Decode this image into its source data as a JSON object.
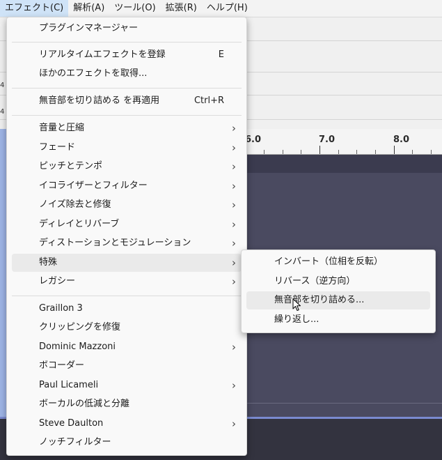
{
  "menubar": {
    "items": [
      "エフェクト(C)",
      "解析(A)",
      "ツール(O)",
      "拡張(R)",
      "ヘルプ(H)"
    ]
  },
  "ruler": {
    "ticks": [
      "6.0",
      "7.0",
      "8.0"
    ]
  },
  "side_digits": [
    "4",
    "4"
  ],
  "effect_menu": {
    "plugin_manager": "プラグインマネージャー",
    "register_realtime": "リアルタイムエフェクトを登録",
    "register_realtime_shortcut": "E",
    "get_more": "ほかのエフェクトを取得...",
    "reapply": "無音部を切り詰める を再適用",
    "reapply_shortcut": "Ctrl+R",
    "categories": [
      "音量と圧縮",
      "フェード",
      "ピッチとテンポ",
      "イコライザーとフィルター",
      "ノイズ除去と修復",
      "ディレイとリバーブ",
      "ディストーションとモジュレーション",
      "特殊",
      "レガシー"
    ],
    "plugins": [
      "Graillon 3",
      "クリッピングを修復",
      "Dominic Mazzoni",
      "ボコーダー",
      "Paul Licameli",
      "ボーカルの低減と分離",
      "Steve Daulton",
      "ノッチフィルター"
    ]
  },
  "special_submenu": {
    "items": [
      "インバート（位相を反転）",
      "リバース（逆方向）",
      "無音部を切り詰める...",
      "繰り返し..."
    ]
  },
  "icons": {
    "submenu_arrow": "chevron-right-icon",
    "cursor": "mouse-pointer-icon"
  },
  "colors": {
    "highlight": "#eaeaea",
    "menubar_active": "#cfe3f7",
    "track": "#4a4a60"
  }
}
